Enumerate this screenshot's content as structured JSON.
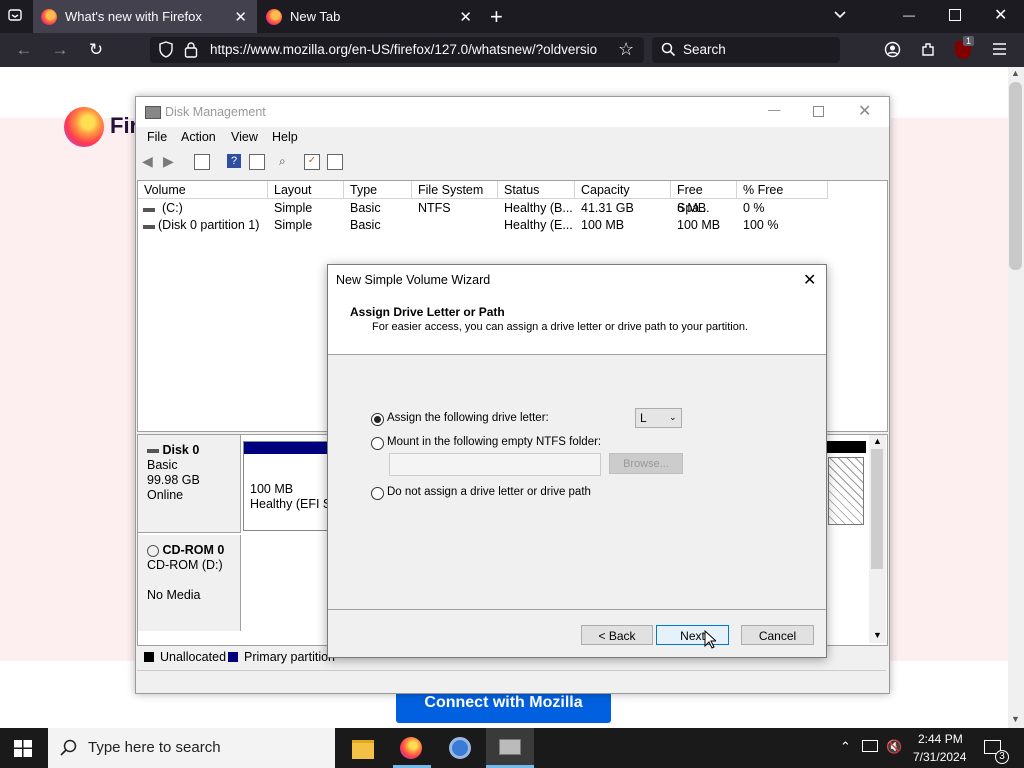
{
  "browser": {
    "tabs": [
      {
        "title": "What's new with Firefox",
        "active": true
      },
      {
        "title": "New Tab",
        "active": false
      }
    ],
    "url": "https://www.mozilla.org/en-US/firefox/127.0/whatsnew/?oldversio",
    "search_placeholder": "Search",
    "ublock_badge": "1"
  },
  "page": {
    "logo_text": "Fir",
    "connect_button": "Connect with Mozilla"
  },
  "disk_management": {
    "title": "Disk Management",
    "menu": [
      "File",
      "Action",
      "View",
      "Help"
    ],
    "columns": [
      "Volume",
      "Layout",
      "Type",
      "File System",
      "Status",
      "Capacity",
      "Free Spa...",
      "% Free"
    ],
    "rows": [
      [
        "(C:)",
        "Simple",
        "Basic",
        "NTFS",
        "Healthy (B...",
        "41.31 GB",
        "6 MB",
        "0 %"
      ],
      [
        "(Disk 0 partition 1)",
        "Simple",
        "Basic",
        "",
        "Healthy (E...",
        "100 MB",
        "100 MB",
        "100 %"
      ]
    ],
    "disk0": {
      "name": "Disk 0",
      "type": "Basic",
      "size": "99.98 GB",
      "state": "Online",
      "partition_size": "100 MB",
      "partition_status": "Healthy (EFI Sy"
    },
    "cdrom0": {
      "name": "CD-ROM 0",
      "drive": "CD-ROM (D:)",
      "media": "No Media"
    },
    "legend": {
      "unallocated": "Unallocated",
      "primary": "Primary partition"
    },
    "colors": {
      "primary": "#00007f",
      "unallocated": "#000000"
    }
  },
  "wizard": {
    "title": "New Simple Volume Wizard",
    "heading": "Assign Drive Letter or Path",
    "subheading": "For easier access, you can assign a drive letter or drive path to your partition.",
    "options": {
      "assign_letter": "Assign the following drive letter:",
      "mount_folder": "Mount in the following empty NTFS folder:",
      "no_assign": "Do not assign a drive letter or drive path"
    },
    "selected_option": "assign_letter",
    "drive_letter": "L",
    "browse_label": "Browse...",
    "buttons": {
      "back": "< Back",
      "next": "Next",
      "cancel": "Cancel"
    }
  },
  "taskbar": {
    "search_placeholder": "Type here to search",
    "time": "2:44 PM",
    "date": "7/31/2024",
    "notification_count": "3"
  }
}
